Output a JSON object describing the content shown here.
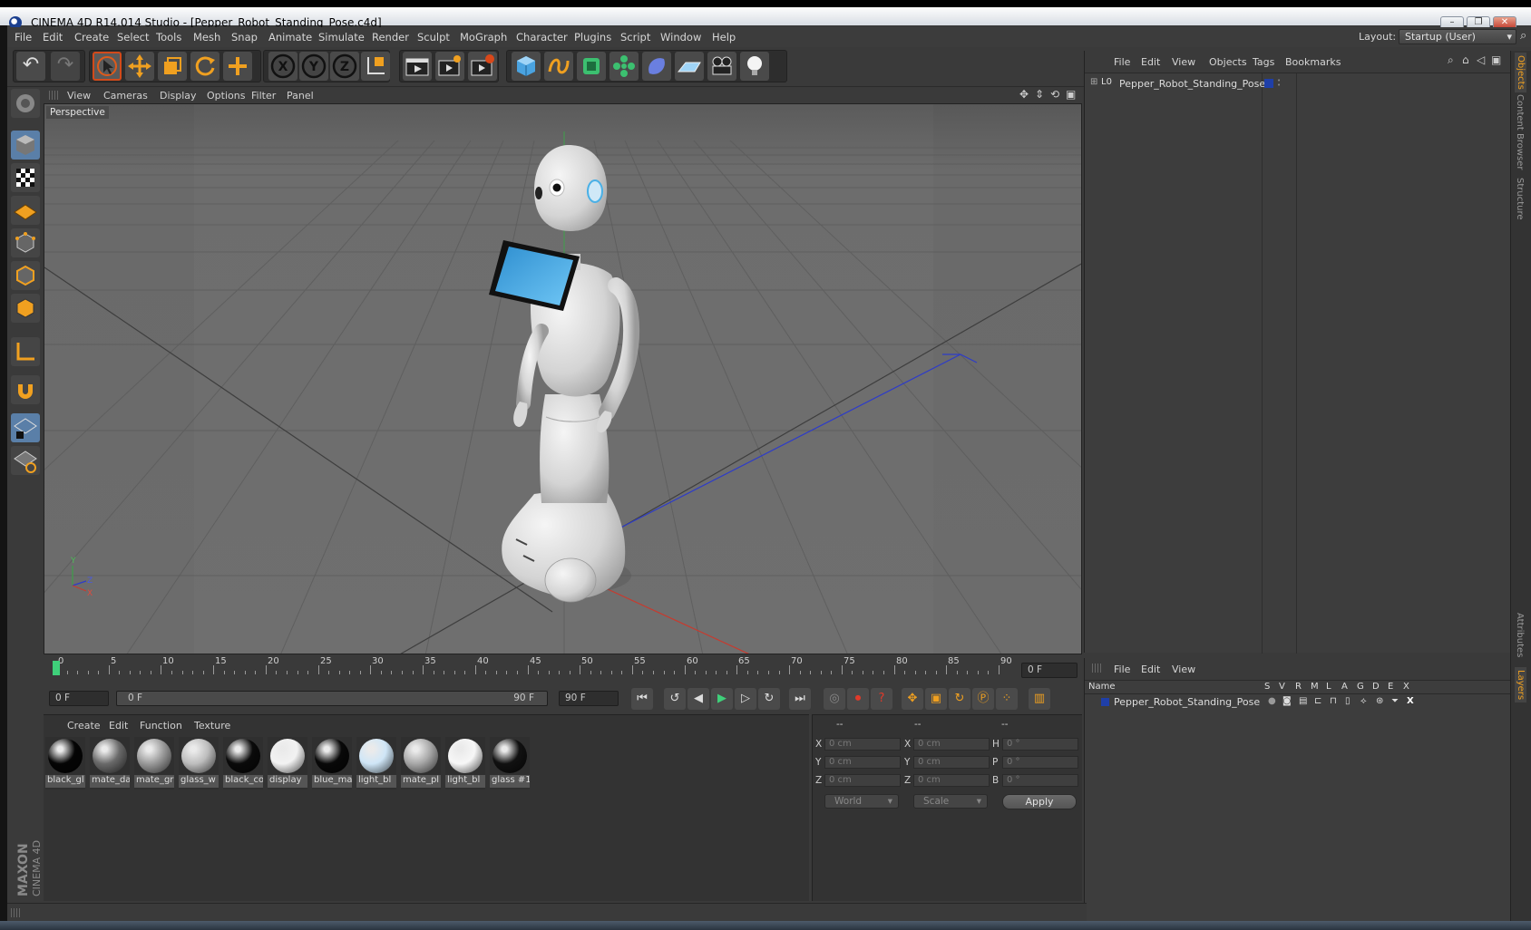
{
  "window": {
    "title": "CINEMA 4D R14.014 Studio - [Pepper_Robot_Standing_Pose.c4d]",
    "controls": [
      "minimize",
      "restore",
      "close"
    ]
  },
  "menubar": {
    "items": [
      "File",
      "Edit",
      "Create",
      "Select",
      "Tools",
      "Mesh",
      "Snap",
      "Animate",
      "Simulate",
      "Render",
      "Sculpt",
      "MoGraph",
      "Character",
      "Plugins",
      "Script",
      "Window",
      "Help"
    ],
    "layout_label": "Layout:",
    "layout_value": "Startup (User)"
  },
  "toolbar": {
    "buttons": [
      "undo-icon",
      "redo-icon",
      "live-selection-icon",
      "move-icon",
      "scale-icon",
      "rotate-icon",
      "add-icon",
      "x-axis-icon",
      "y-axis-icon",
      "z-axis-icon",
      "coordinate-system-icon",
      "render-view-icon",
      "render-picture-viewer-icon",
      "edit-render-settings-icon",
      "cube-icon",
      "spline-icon",
      "nurbs-icon",
      "array-icon",
      "deformer-icon",
      "floor-icon",
      "camera-icon",
      "light-icon"
    ]
  },
  "viewport": {
    "menu": [
      "View",
      "Cameras",
      "Display",
      "Options",
      "Filter",
      "Panel"
    ],
    "label": "Perspective"
  },
  "timeline": {
    "ticks": [
      "0",
      "5",
      "10",
      "15",
      "20",
      "25",
      "30",
      "35",
      "40",
      "45",
      "50",
      "55",
      "60",
      "65",
      "70",
      "75",
      "80",
      "85",
      "90"
    ],
    "current_frame": "0 F",
    "start_field": "0 F",
    "range_start": "0 F",
    "range_end": "90 F",
    "end_field": "90 F"
  },
  "materials": {
    "menu": [
      "Create",
      "Edit",
      "Function",
      "Texture"
    ],
    "items": [
      {
        "name": "black_gl",
        "color": "#050505"
      },
      {
        "name": "mate_da",
        "color": "#6a6a6a"
      },
      {
        "name": "mate_gr",
        "color": "#9a9a9a"
      },
      {
        "name": "glass_w",
        "color": "#bdbdbd"
      },
      {
        "name": "black_co",
        "color": "#0a0a0a"
      },
      {
        "name": "display",
        "color": "#f2f2f2"
      },
      {
        "name": "blue_ma",
        "color": "#080808"
      },
      {
        "name": "light_bl",
        "color": "#cfe6f7"
      },
      {
        "name": "mate_pl",
        "color": "#a8a8a8"
      },
      {
        "name": "light_bl",
        "color": "#f7f7f7"
      },
      {
        "name": "glass #1",
        "color": "#111111"
      }
    ]
  },
  "coordinates": {
    "header": [
      "--",
      "--",
      "--"
    ],
    "rows": [
      {
        "axis": "X",
        "pos": "0 cm",
        "axis2": "X",
        "size": "0 cm",
        "rot_label": "H",
        "rot": "0 °"
      },
      {
        "axis": "Y",
        "pos": "0 cm",
        "axis2": "Y",
        "size": "0 cm",
        "rot_label": "P",
        "rot": "0 °"
      },
      {
        "axis": "Z",
        "pos": "0 cm",
        "axis2": "Z",
        "size": "0 cm",
        "rot_label": "B",
        "rot": "0 °"
      }
    ],
    "world_select": "World",
    "scale_select": "Scale",
    "apply_label": "Apply"
  },
  "objects_panel": {
    "menu": [
      "File",
      "Edit",
      "View",
      "Objects",
      "Tags",
      "Bookmarks"
    ],
    "tree": [
      {
        "name": "Pepper_Robot_Standing_Pose",
        "color": "#1f3fa8"
      }
    ]
  },
  "layers_panel": {
    "menu": [
      "File",
      "Edit",
      "View"
    ],
    "columns": [
      "Name",
      "S",
      "V",
      "R",
      "M",
      "L",
      "A",
      "G",
      "D",
      "E",
      "X"
    ],
    "rows": [
      {
        "name": "Pepper_Robot_Standing_Pose",
        "color": "#1f3fa8"
      }
    ]
  },
  "side_tabs": [
    "Objects",
    "Content Browser",
    "Structure"
  ],
  "side_tabs_lower": [
    "Attributes",
    "Layers"
  ],
  "branding": {
    "maxon": "MAXON",
    "product": "CINEMA 4D"
  }
}
